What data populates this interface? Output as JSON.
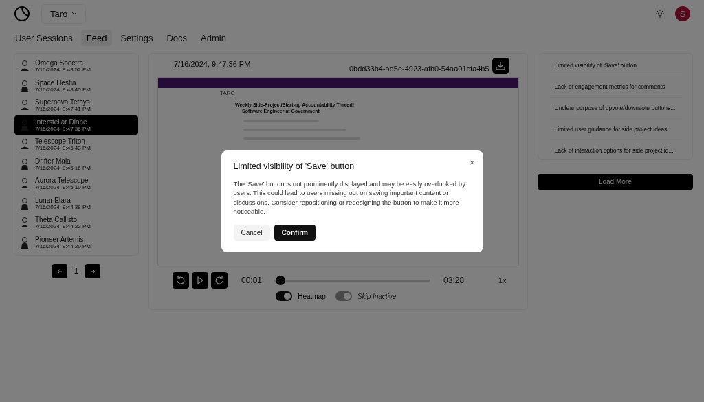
{
  "header": {
    "workspace": "Taro",
    "avatar": "S"
  },
  "nav": [
    {
      "label": "User Sessions",
      "selected": false
    },
    {
      "label": "Feed",
      "selected": true
    },
    {
      "label": "Settings",
      "selected": false
    },
    {
      "label": "Docs",
      "selected": false
    },
    {
      "label": "Admin",
      "selected": false
    }
  ],
  "sessions": [
    {
      "name": "Omega Spectra",
      "time": "7/16/2024, 9:48:52 PM",
      "selected": false
    },
    {
      "name": "Space Hestia",
      "time": "7/16/2024, 9:48:40 PM",
      "selected": false
    },
    {
      "name": "Supernova Tethys",
      "time": "7/16/2024, 9:47:41 PM",
      "selected": false
    },
    {
      "name": "Interstellar Dione",
      "time": "7/16/2024, 9:47:36 PM",
      "selected": true
    },
    {
      "name": "Telescope Triton",
      "time": "7/16/2024, 9:45:43 PM",
      "selected": false
    },
    {
      "name": "Drifter Maia",
      "time": "7/16/2024, 9:45:16 PM",
      "selected": false
    },
    {
      "name": "Aurora Telescope",
      "time": "7/16/2024, 9:45:10 PM",
      "selected": false
    },
    {
      "name": "Lunar Elara",
      "time": "7/16/2024, 9:44:38 PM",
      "selected": false
    },
    {
      "name": "Theta Callisto",
      "time": "7/16/2024, 9:44:22 PM",
      "selected": false
    },
    {
      "name": "Pioneer Artemis",
      "time": "7/16/2024, 9:44:20 PM",
      "selected": false
    }
  ],
  "pagination": {
    "page": "1"
  },
  "player": {
    "timestamp": "7/16/2024, 9:47:36 PM",
    "session_id": "0bdd33b4-ad5e-4923-afb0-54aa01cfa4b5",
    "recording": {
      "brand": "TARO",
      "title": "Weekly Side-Project/Start-up Accountability Thread!",
      "author": "Software Engineer at Government"
    },
    "current_time": "00:01",
    "duration": "03:28",
    "level": 0.01,
    "speed": "1x",
    "toggles": [
      {
        "label": "Heatmap",
        "on": true,
        "disabled": false
      },
      {
        "label": "Skip Inactive",
        "on": true,
        "disabled": true
      }
    ]
  },
  "issues": [
    "Limited visibility of 'Save' button",
    "Lack of engagement metrics for comments",
    "Unclear purpose of upvote/downvote buttons...",
    "Limited user guidance for side project ideas",
    "Lack of interaction options for side project id..."
  ],
  "load_more": "Load More",
  "dialog": {
    "title": "Limited visibility of 'Save' button",
    "body": "The 'Save' button is not prominently displayed and may be easily overlooked by users. This could lead to users missing out on saving important content or discussions. Consider repositioning or redesigning the button to make it more noticeable.",
    "close": "×",
    "buttons": [
      "Cancel",
      "Confirm"
    ]
  }
}
